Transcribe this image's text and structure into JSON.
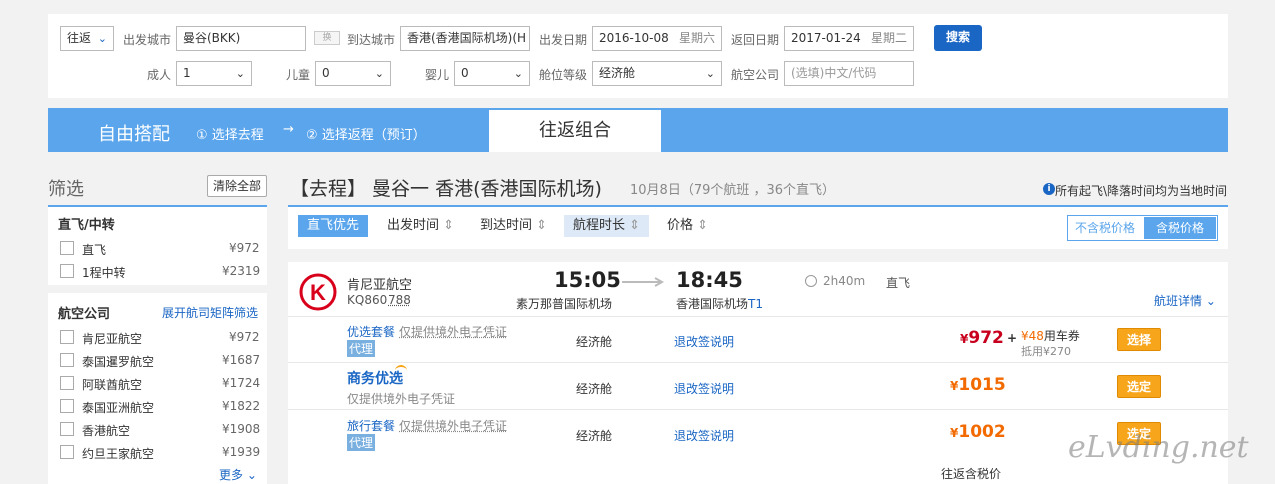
{
  "search": {
    "trip_type": "往返",
    "depart_city_label": "出发城市",
    "depart_city": "曼谷(BKK)",
    "swap_label": "换",
    "arrive_city_label": "到达城市",
    "arrive_city": "香港(香港国际机场)(H",
    "depart_date_label": "出发日期",
    "depart_date": "2016-10-08",
    "depart_weekday": "星期六",
    "return_date_label": "返回日期",
    "return_date": "2017-01-24",
    "return_weekday": "星期二",
    "search_button": "搜索",
    "adult_label": "成人",
    "adult_value": "1",
    "child_label": "儿童",
    "child_value": "0",
    "infant_label": "婴儿",
    "infant_value": "0",
    "cabin_label": "舱位等级",
    "cabin_value": "经济舱",
    "airline_label": "航空公司",
    "airline_placeholder": "(选填)中文/代码"
  },
  "tabs": {
    "free_combo": "自由搭配",
    "step1": "① 选择去程",
    "arrow": "→",
    "step2": "② 选择返程（预订）",
    "round_trip_combo": "往返组合"
  },
  "filter": {
    "title": "筛选",
    "clear_all": "清除全部",
    "stops_title": "直飞/中转",
    "stops": [
      {
        "label": "直飞",
        "price": "¥972"
      },
      {
        "label": "1程中转",
        "price": "¥2319"
      }
    ],
    "airline_title": "航空公司",
    "airline_matrix_link": "展开航司矩阵筛选",
    "airlines": [
      {
        "label": "肯尼亚航空",
        "price": "¥972"
      },
      {
        "label": "泰国暹罗航空",
        "price": "¥1687"
      },
      {
        "label": "阿联酋航空",
        "price": "¥1724"
      },
      {
        "label": "泰国亚洲航空",
        "price": "¥1822"
      },
      {
        "label": "香港航空",
        "price": "¥1908"
      },
      {
        "label": "约旦王家航空",
        "price": "¥1939"
      }
    ],
    "more": "更多"
  },
  "results": {
    "title": "【去程】 曼谷一 香港(香港国际机场)",
    "subtitle": "10月8日（79个航班 ，36个直飞）",
    "timezone_note": "所有起飞\\降落时间均为当地时间",
    "sort": [
      {
        "label": "直飞优先",
        "arrows": ""
      },
      {
        "label": "出发时间",
        "arrows": "⇕"
      },
      {
        "label": "到达时间",
        "arrows": "⇕"
      },
      {
        "label": "航程时长",
        "arrows": "⇕"
      },
      {
        "label": "价格",
        "arrows": "⇕"
      }
    ],
    "tax_excl": "不含税价格",
    "tax_incl": "含税价格"
  },
  "flight": {
    "airline": "肯尼亚航空",
    "flight_no": "KQ860",
    "aircraft": "788",
    "dep_time": "15:05",
    "dep_airport": "素万那普国际机场",
    "arr_time": "18:45",
    "arr_airport": "香港国际机场",
    "arr_terminal": "T1",
    "duration": "2h40m",
    "direct": "直飞",
    "details_link": "航班详情",
    "logo_letter": "K",
    "brand_color": "#d8001a"
  },
  "fares": [
    {
      "name": "优选套餐",
      "note": "仅提供境外电子凭证",
      "agent_tag": "代理",
      "cabin": "经济舱",
      "rule_link": "退改签说明",
      "currency": "¥",
      "price": "972",
      "plus": "+",
      "coupon_currency": "¥",
      "coupon_amount": "48",
      "coupon_label": "用车券",
      "coupon_note": "抵用¥270",
      "button": "选择"
    },
    {
      "name": "商务优选",
      "note": "仅提供境外电子凭证",
      "cabin": "经济舱",
      "rule_link": "退改签说明",
      "currency": "¥",
      "price": "1015",
      "button": "选定"
    },
    {
      "name": "旅行套餐",
      "note": "仅提供境外电子凭证",
      "agent_tag": "代理",
      "cabin": "经济舱",
      "rule_link": "退改签说明",
      "currency": "¥",
      "price": "1002",
      "button": "选定"
    }
  ],
  "footer_note": "往返含税价",
  "watermark": "eLvding.net"
}
